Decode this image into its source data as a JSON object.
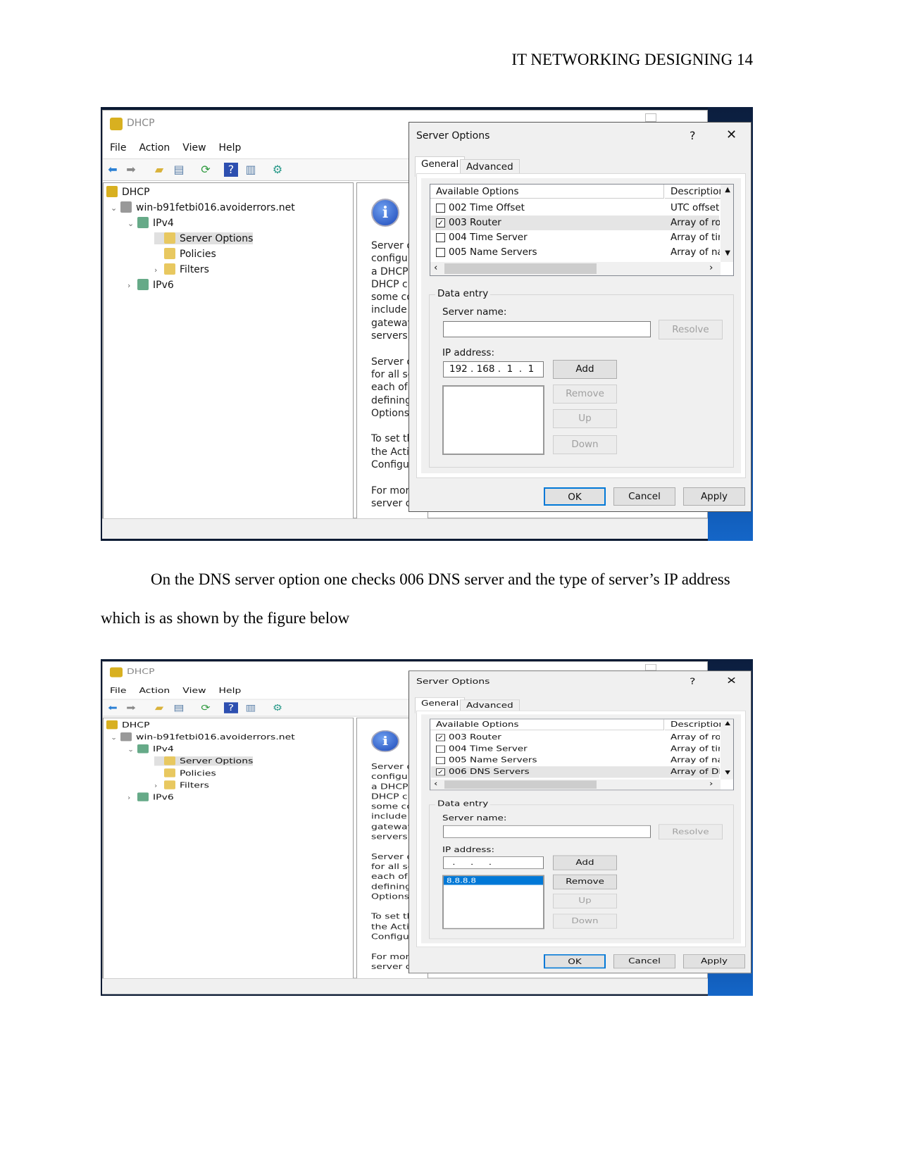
{
  "header": "IT NETWORKING DESIGNING 14",
  "paragraph": {
    "line1": "On the DNS server option one checks 006 DNS server and the type of server’s IP address",
    "line2": "which is as shown by the figure below"
  },
  "screenshots": [
    {
      "window_title": "DHCP",
      "menu": [
        "File",
        "Action",
        "View",
        "Help"
      ],
      "toolbar": [
        "back-arrow",
        "forward-arrow",
        "up-folder",
        "show-hide-console-tree",
        "refresh",
        "help",
        "show-hide-action-pane",
        "dhcp-gears"
      ],
      "tree": [
        {
          "label": "DHCP",
          "level": 0,
          "icon": "dhcp"
        },
        {
          "label": "win-b91fetbi016.avoiderrors.net",
          "level": 1,
          "expander": "v",
          "icon": "server"
        },
        {
          "label": "IPv4",
          "level": 2,
          "expander": "v",
          "icon": "ipv4"
        },
        {
          "label": "Server Options",
          "level": 3,
          "icon": "folder",
          "selected": true
        },
        {
          "label": "Policies",
          "level": 3,
          "icon": "folder"
        },
        {
          "label": "Filters",
          "level": 3,
          "expander": ">",
          "icon": "filter"
        },
        {
          "label": "IPv6",
          "level": 2,
          "expander": ">",
          "icon": "ipv6"
        }
      ],
      "description_lines": [
        "Server o",
        "configur",
        "a DHCP",
        "DHCP cl",
        "some co",
        "include l",
        "gateway",
        "servers, a",
        "",
        "Server o",
        "for all sc",
        "each of t",
        "defining",
        "Options.",
        "",
        "To set th",
        "the Actio",
        "Configu",
        "",
        "For mor",
        "server o"
      ],
      "dialog": {
        "title": "Server Options",
        "help": "?",
        "close": "✕",
        "tabs": [
          "General",
          "Advanced"
        ],
        "columns": [
          "Available Options",
          "Description"
        ],
        "options": [
          {
            "name": "002 Time Offset",
            "desc": "UTC offset i",
            "checked": false
          },
          {
            "name": "003 Router",
            "desc": "Array of rout",
            "checked": true,
            "selected": true
          },
          {
            "name": "004 Time Server",
            "desc": "Array of time",
            "checked": false
          },
          {
            "name": "005 Name Servers",
            "desc": "Array of nam",
            "checked": false
          }
        ],
        "group": "Data entry",
        "server_name_label": "Server name:",
        "server_name_value": "",
        "resolve": "Resolve",
        "ip_label": "IP address:",
        "ip_value": "192 . 168 .  1  .  1",
        "ip_list": [],
        "add": "Add",
        "remove": "Remove",
        "up": "Up",
        "down": "Down",
        "enabled": {
          "add": true,
          "remove": false,
          "up": false,
          "down": false
        },
        "ok": "OK",
        "cancel": "Cancel",
        "apply": "Apply"
      }
    },
    {
      "window_title": "DHCP",
      "menu": [
        "File",
        "Action",
        "View",
        "Help"
      ],
      "toolbar": [
        "back-arrow",
        "forward-arrow",
        "up-folder",
        "show-hide-console-tree",
        "refresh",
        "help",
        "show-hide-action-pane",
        "dhcp-gears"
      ],
      "tree": [
        {
          "label": "DHCP",
          "level": 0,
          "icon": "dhcp"
        },
        {
          "label": "win-b91fetbi016.avoiderrors.net",
          "level": 1,
          "expander": "v",
          "icon": "server"
        },
        {
          "label": "IPv4",
          "level": 2,
          "expander": "v",
          "icon": "ipv4"
        },
        {
          "label": "Server Options",
          "level": 3,
          "icon": "folder",
          "selected": true
        },
        {
          "label": "Policies",
          "level": 3,
          "icon": "folder"
        },
        {
          "label": "Filters",
          "level": 3,
          "expander": ">",
          "icon": "filter"
        },
        {
          "label": "IPv6",
          "level": 2,
          "expander": ">",
          "icon": "ipv6"
        }
      ],
      "description_lines": [
        "Server o",
        "configur",
        "a DHCP",
        "DHCP cl",
        "some co",
        "include l",
        "gateway",
        "servers, a",
        "",
        "Server o",
        "for all sc",
        "each of t",
        "defining",
        "Options.",
        "",
        "To set th",
        "the Actio",
        "Configu",
        "",
        "For mor",
        "server o"
      ],
      "dialog": {
        "title": "Server Options",
        "help": "?",
        "close": "✕",
        "tabs": [
          "General",
          "Advanced"
        ],
        "columns": [
          "Available Options",
          "Description"
        ],
        "options": [
          {
            "name": "003 Router",
            "desc": "Array of rout",
            "checked": true
          },
          {
            "name": "004 Time Server",
            "desc": "Array of time",
            "checked": false
          },
          {
            "name": "005 Name Servers",
            "desc": "Array of nam",
            "checked": false
          },
          {
            "name": "006 DNS Servers",
            "desc": "Array of DN",
            "checked": true,
            "selected": true
          }
        ],
        "group": "Data entry",
        "server_name_label": "Server name:",
        "server_name_value": "",
        "resolve": "Resolve",
        "ip_label": "IP address:",
        "ip_value": " .     .     . ",
        "ip_list": [
          "8.8.8.8"
        ],
        "add": "Add",
        "remove": "Remove",
        "up": "Up",
        "down": "Down",
        "enabled": {
          "add": true,
          "remove": true,
          "up": false,
          "down": false
        },
        "ok": "OK",
        "cancel": "Cancel",
        "apply": "Apply"
      }
    }
  ],
  "colors": {
    "selection": "#0078d7",
    "desktop": "#0a3f8a",
    "dialog_bg": "#f0f0f0"
  }
}
